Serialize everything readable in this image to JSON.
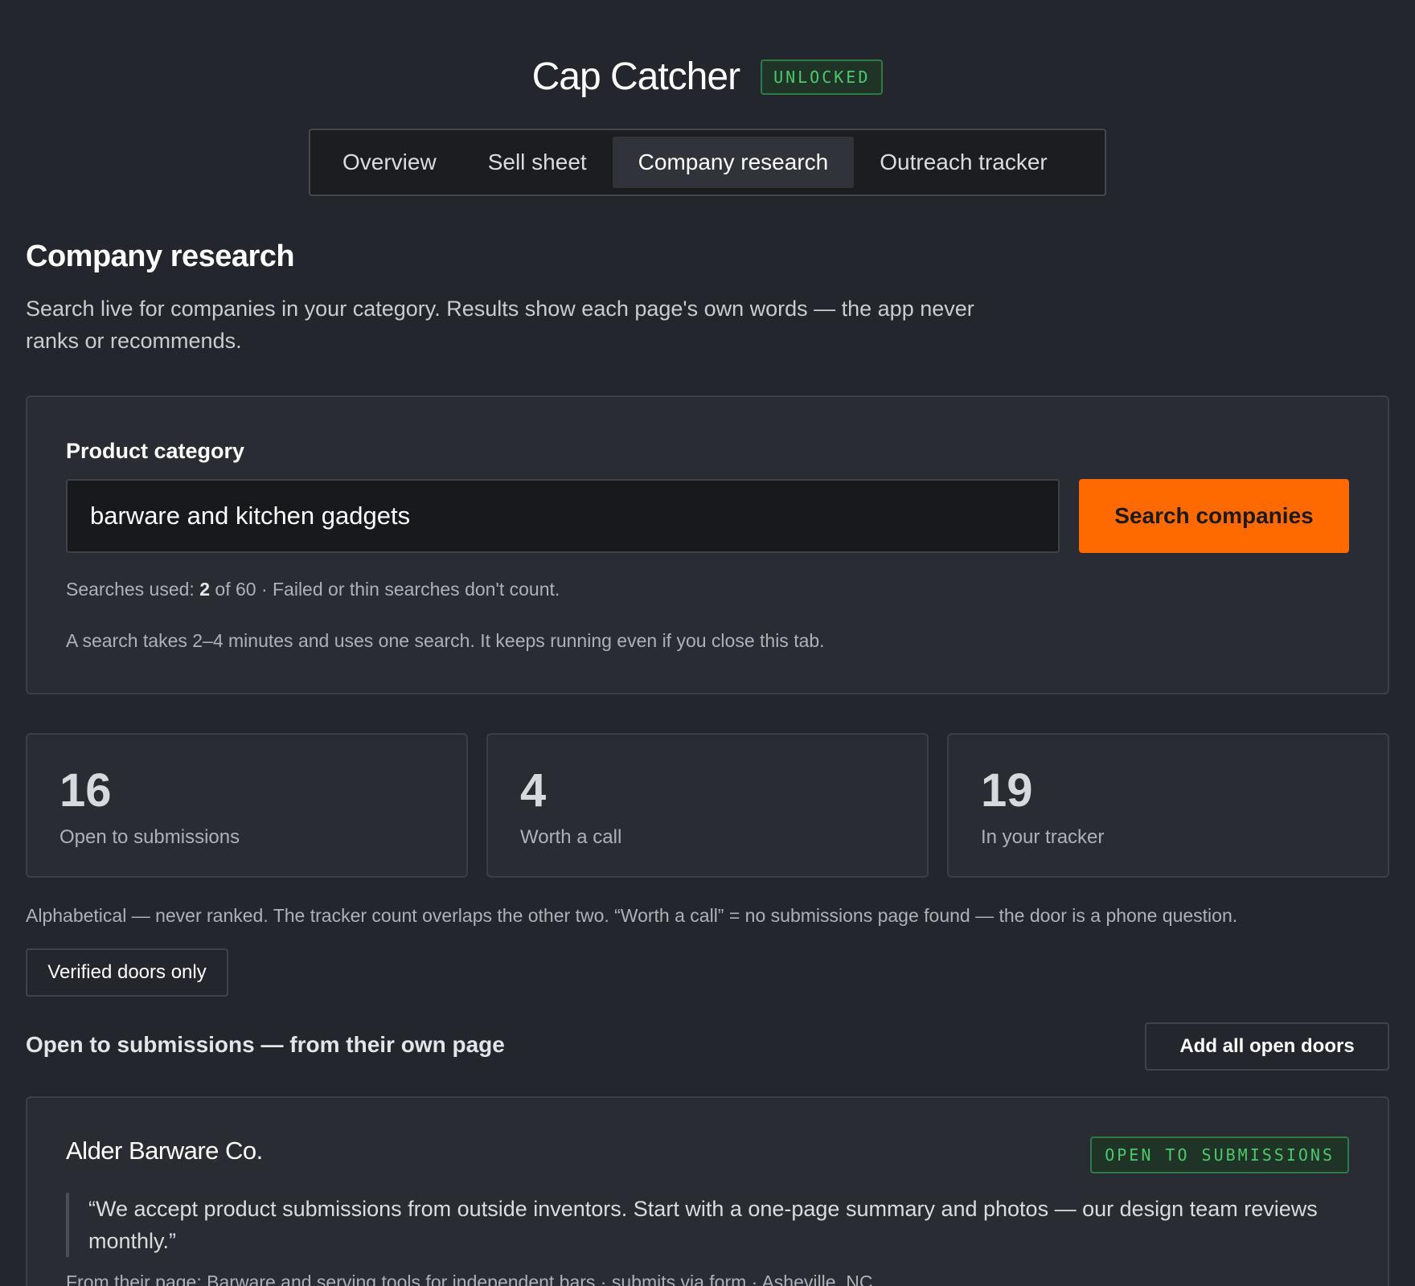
{
  "app": {
    "title": "Cap Catcher",
    "badge": "UNLOCKED"
  },
  "tabs": [
    {
      "label": "Overview"
    },
    {
      "label": "Sell sheet"
    },
    {
      "label": "Company research"
    },
    {
      "label": "Outreach tracker"
    }
  ],
  "section": {
    "title": "Company research",
    "description": "Search live for companies in your category. Results show each page's own words — the app never ranks or recommends."
  },
  "search": {
    "label": "Product category",
    "value": "barware and kitchen gadgets",
    "button": "Search companies",
    "usage_prefix": "Searches used: ",
    "usage_used": "2",
    "usage_suffix": " of 60 · Failed or thin searches don't count.",
    "note": "A search takes 2–4 minutes and uses one search. It keeps running even if you close this tab."
  },
  "stats": [
    {
      "value": "16",
      "label": "Open to submissions"
    },
    {
      "value": "4",
      "label": "Worth a call"
    },
    {
      "value": "19",
      "label": "In your tracker"
    }
  ],
  "footnote": "Alphabetical — never ranked. The tracker count overlaps the other two. “Worth a call” = no submissions page found — the door is a phone question.",
  "filter": {
    "label": "Verified doors only"
  },
  "list": {
    "title": "Open to submissions — from their own page",
    "add_all": "Add all open doors"
  },
  "companies": [
    {
      "name": "Alder Barware Co.",
      "status": "OPEN TO SUBMISSIONS",
      "quote": "“We accept product submissions from outside inventors. Start with a one-page summary and photos — our design team reviews monthly.”",
      "meta": "From their page: Barware and serving tools for independent bars · submits via form · Asheville, NC"
    }
  ],
  "colors": {
    "accent": "#ff6a00",
    "success": "#4cc96a",
    "background": "#23262c"
  }
}
